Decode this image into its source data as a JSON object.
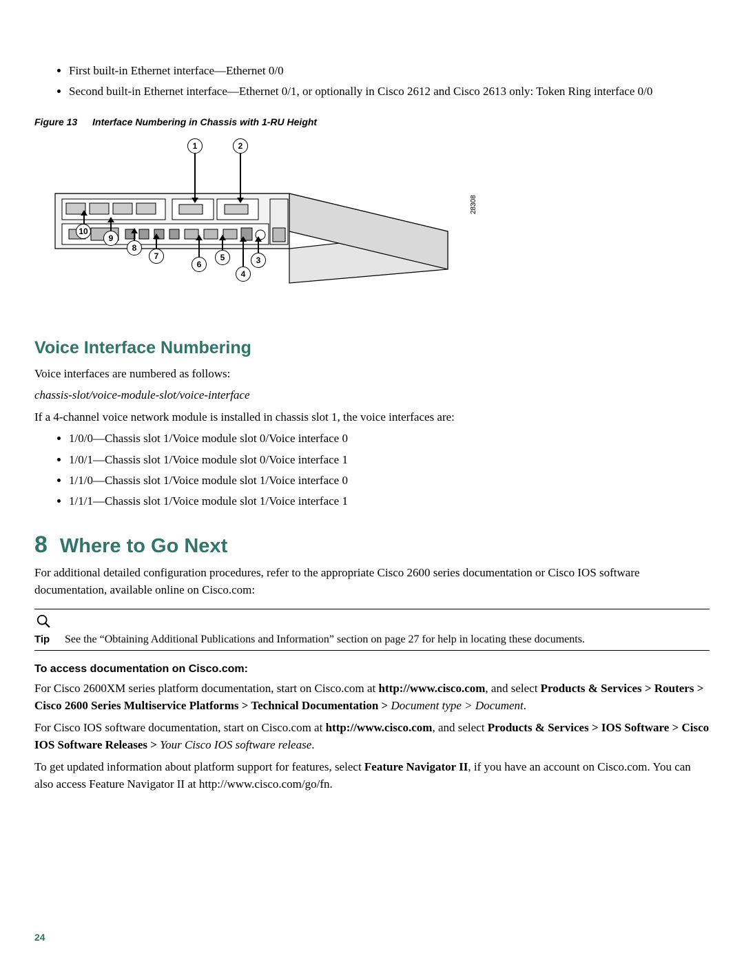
{
  "top_bullets": [
    "First built-in Ethernet interface—Ethernet 0/0",
    "Second built-in Ethernet interface—Ethernet 0/1, or optionally in Cisco 2612 and Cisco 2613 only: Token Ring interface 0/0"
  ],
  "figure": {
    "num": "Figure 13",
    "title": "Interface Numbering in Chassis with 1-RU Height",
    "side_id": "28308",
    "callouts": [
      "1",
      "2",
      "3",
      "4",
      "5",
      "6",
      "7",
      "8",
      "9",
      "10"
    ]
  },
  "voice": {
    "heading": "Voice Interface Numbering",
    "intro": "Voice interfaces are numbered as follows:",
    "format": "chassis-slot/voice-module-slot/voice-interface",
    "cond": "If a 4-channel voice network module is installed in chassis slot 1, the voice interfaces are:",
    "items": [
      "1/0/0—Chassis slot 1/Voice module slot 0/Voice interface 0",
      "1/0/1—Chassis slot 1/Voice module slot 0/Voice interface 1",
      "1/1/0—Chassis slot 1/Voice module slot 1/Voice interface 0",
      "1/1/1—Chassis slot 1/Voice module slot 1/Voice interface 1"
    ]
  },
  "next": {
    "num": "8",
    "heading": "Where to Go Next",
    "intro": "For additional detailed configuration procedures, refer to the appropriate Cisco 2600 series documentation or Cisco IOS software documentation, available online on Cisco.com:",
    "tip_label": "Tip",
    "tip_text": "See the “Obtaining Additional Publications and Information” section on page 27 for help in locating these documents.",
    "access_head": "To access documentation on Cisco.com:",
    "p1_a": "For Cisco 2600XM series platform documentation, start on Cisco.com at ",
    "p1_url": "http://www.cisco.com",
    "p1_b": ", and select ",
    "p1_path": "Products & Services > Routers > Cisco 2600 Series Multiservice Platforms > Technical Documentation > ",
    "p1_var": "Document type > Document",
    "p1_end": ".",
    "p2_a": "For Cisco IOS software documentation, start on Cisco.com at ",
    "p2_url": "http://www.cisco.com",
    "p2_b": ", and select ",
    "p2_path": "Products & Services > IOS Software > Cisco IOS Software Releases > ",
    "p2_var": "Your Cisco IOS software release",
    "p2_end": ".",
    "p3_a": "To get updated information about platform support for features, select ",
    "p3_b": "Feature Navigator II",
    "p3_c": ", if you have an account on Cisco.com. You can also access Feature Navigator II at http://www.cisco.com/go/fn."
  },
  "page_number": "24"
}
